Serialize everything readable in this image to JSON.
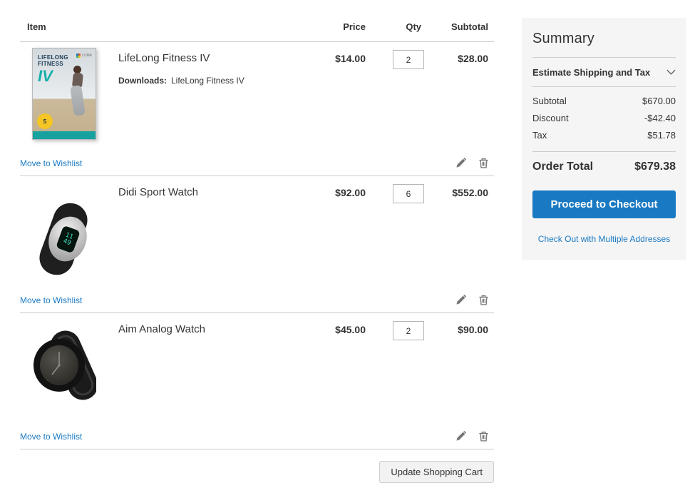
{
  "table": {
    "headers": {
      "item": "Item",
      "price": "Price",
      "qty": "Qty",
      "subtotal": "Subtotal"
    },
    "move_to_wishlist_label": "Move to Wishlist",
    "update_cart_label": "Update Shopping Cart",
    "items": [
      {
        "name": "LifeLong Fitness IV",
        "option_label": "Downloads:",
        "option_value": "LifeLong Fitness IV",
        "price": "$14.00",
        "qty": "2",
        "subtotal": "$28.00"
      },
      {
        "name": "Didi Sport Watch",
        "price": "$92.00",
        "qty": "6",
        "subtotal": "$552.00"
      },
      {
        "name": "Aim Analog Watch",
        "price": "$45.00",
        "qty": "2",
        "subtotal": "$90.00"
      }
    ]
  },
  "summary": {
    "title": "Summary",
    "estimate_label": "Estimate Shipping and Tax",
    "rows": [
      {
        "label": "Subtotal",
        "value": "$670.00"
      },
      {
        "label": "Discount",
        "value": "-$42.40"
      },
      {
        "label": "Tax",
        "value": "$51.78"
      }
    ],
    "order_total_label": "Order Total",
    "order_total_value": "$679.38",
    "checkout_label": "Proceed to Checkout",
    "multi_address_label": "Check Out with Multiple Addresses"
  },
  "product_art": {
    "dvd": {
      "title_line1": "LIFELONG",
      "title_line2": "FITNESS",
      "iv": "IV",
      "brand": "LUMA",
      "badge": "5"
    },
    "didi": {
      "time": "11\n49"
    }
  },
  "colors": {
    "accent_blue": "#1979c3",
    "panel_bg": "#f5f5f5",
    "border_gray": "#cccccc"
  }
}
